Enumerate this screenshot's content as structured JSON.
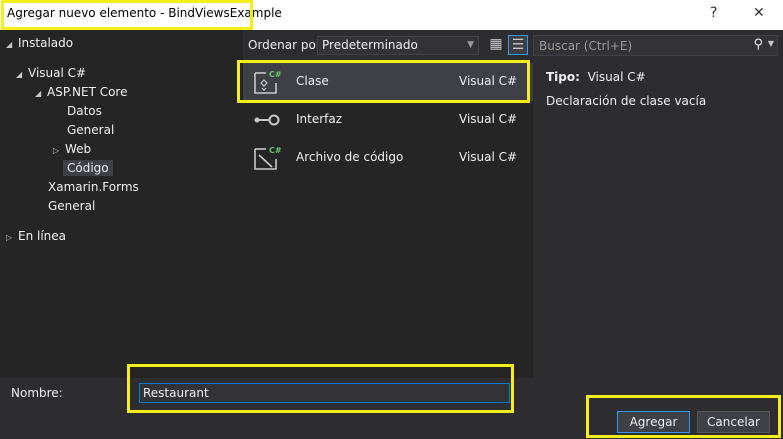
{
  "window": {
    "title": "Agregar nuevo elemento - BindViewsExample",
    "help_label": "?",
    "close_label": "✕"
  },
  "tree": {
    "installed": "Instalado",
    "visual_csharp": "Visual C#",
    "aspnet_core": "ASP.NET Core",
    "datos": "Datos",
    "general_sub": "General",
    "web": "Web",
    "codigo": "Código",
    "xamarin": "Xamarin.Forms",
    "general": "General",
    "online": "En línea"
  },
  "toolbar": {
    "sort_label": "Ordenar por:",
    "sort_value": "Predeterminado"
  },
  "search": {
    "placeholder": "Buscar (Ctrl+E)"
  },
  "templates": [
    {
      "name": "Clase",
      "lang": "Visual C#",
      "icon": "class-icon",
      "selected": true
    },
    {
      "name": "Interfaz",
      "lang": "Visual C#",
      "icon": "interface-icon",
      "selected": false
    },
    {
      "name": "Archivo de código",
      "lang": "Visual C#",
      "icon": "code-file-icon",
      "selected": false
    }
  ],
  "details": {
    "type_label": "Tipo:",
    "type_value": "Visual C#",
    "description": "Declaración de clase vacía"
  },
  "form": {
    "name_label": "Nombre:",
    "name_value": "Restaurant"
  },
  "buttons": {
    "add": "Agregar",
    "cancel": "Cancelar"
  },
  "colors": {
    "highlight": "#f4ef1a",
    "accent": "#007acc",
    "csharp_green": "#68c76c"
  }
}
